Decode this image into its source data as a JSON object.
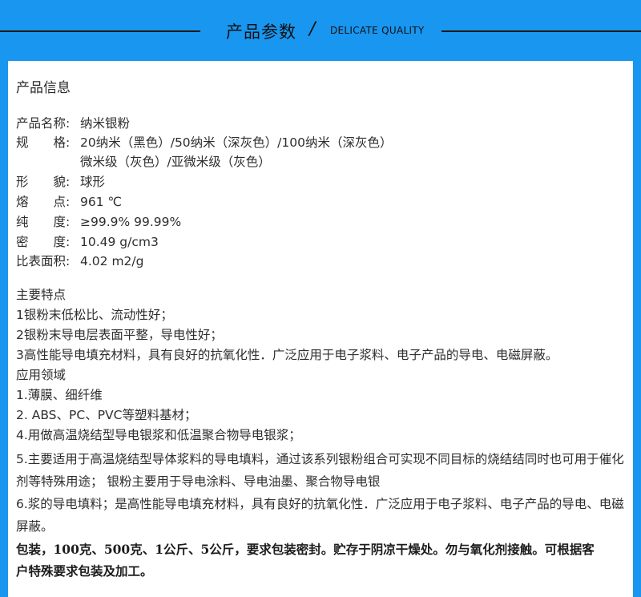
{
  "header": {
    "title": "产品参数",
    "slash": "/",
    "subtitle": "DELICATE QUALITY"
  },
  "section_info": {
    "title": "产品信息",
    "rows": [
      {
        "label": "产品名称:",
        "value": "纳米银粉"
      },
      {
        "label": "规　　格:",
        "value": "20纳米（黑色）/50纳米（深灰色）/100纳米（深灰色）",
        "value2": "微米级（灰色）/亚微米级（灰色）"
      },
      {
        "label": "形　　貌:",
        "value": "球形"
      },
      {
        "label": "熔　　点:",
        "value": "961 ℃"
      },
      {
        "label": "纯　　度:",
        "value": "≥99.9% 99.99%"
      },
      {
        "label": "密　　度:",
        "value": "10.49 g/cm3"
      },
      {
        "label": "比表面积:",
        "value": "4.02 m2/g"
      }
    ]
  },
  "features": {
    "title": "主要特点",
    "items": [
      "1银粉末低松比、流动性好；",
      "2银粉末导电层表面平整，导电性好；",
      "3高性能导电填充材料，具有良好的抗氧化性．广泛应用于电子浆料、电子产品的导电、电磁屏蔽。"
    ]
  },
  "applications": {
    "title": "应用领域",
    "items": [
      "1.薄膜、细纤维",
      "2. ABS、PC、PVC等塑料基材；",
      "4.用做高温烧结型导电银浆和低温聚合物导电银浆；",
      "5.主要适用于高温烧结型导体浆料的导电填料，通过该系列银粉组合可实现不同目标的烧结结同时也可用于催化",
      "剂等特殊用途；  银粉主要用于导电涂料、导电油墨、聚合物导电银",
      "6.浆的导电填料；是高性能导电填充材料，具有良好的抗氧化性．广泛应用于电子浆料、电子产品的导电、电磁",
      "屏蔽。"
    ]
  },
  "packaging": {
    "line1": "包装，100克、500克、1公斤、5公斤，要求包装密封。贮存于阴凉干燥处。勿与氧化剂接触。可根据客",
    "line2": "户特殊要求包装及加工。"
  }
}
